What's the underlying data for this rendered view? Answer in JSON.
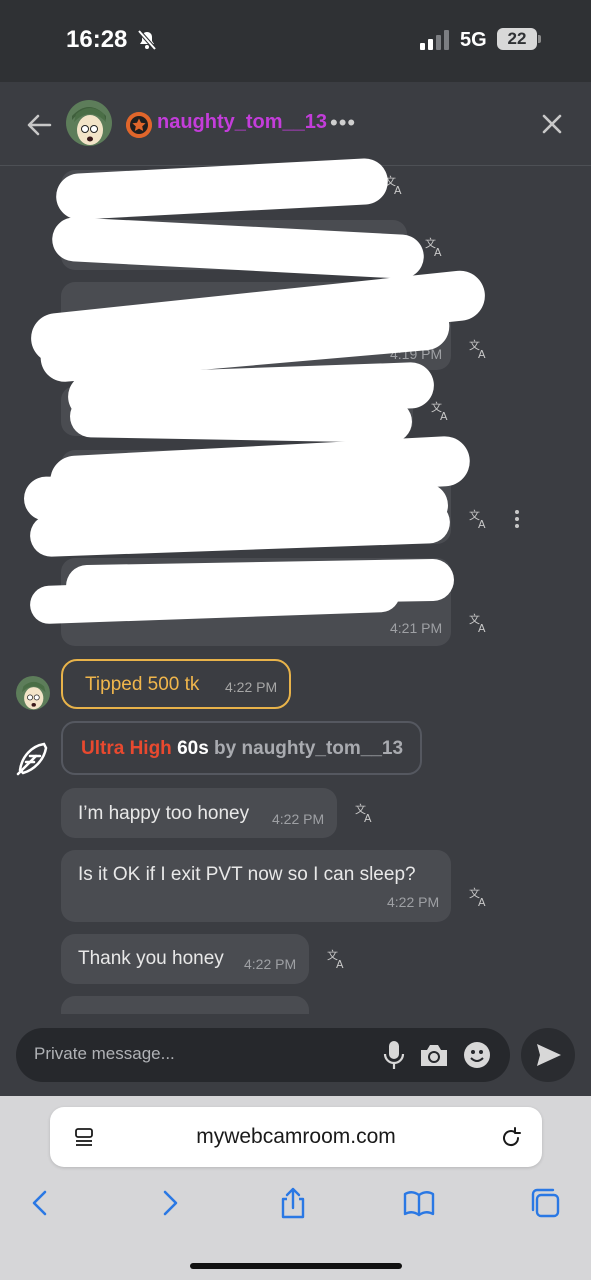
{
  "status_bar": {
    "time": "16:28",
    "network": "5G",
    "battery": "22"
  },
  "header": {
    "username": "naughty_tom__13",
    "username_color": "#c33dda",
    "badge_color": "#e0662b",
    "more": "•••"
  },
  "messages": {
    "time_1": "4:19 PM",
    "time_2": "4:21 PM",
    "m1_text": "I’m happy too honey",
    "m1_time": "4:22 PM",
    "m2_text": "Is it OK if I exit PVT now so I can sleep?",
    "m2_time": "4:22 PM",
    "m3_text": "Thank you honey",
    "m3_time": "4:22 PM"
  },
  "tip": {
    "label": "Tipped 500 tk",
    "time": "4:22 PM",
    "border_color": "#e8b34a"
  },
  "ultra": {
    "level": "Ultra High",
    "duration": "60s",
    "by": "by",
    "user": "naughty_tom__13",
    "level_color": "#e8492f"
  },
  "composer": {
    "placeholder": "Private message..."
  },
  "browser": {
    "url": "mywebcamroom.com"
  },
  "icons": [
    "bell-slash-icon",
    "signal-icon",
    "back-arrow-icon",
    "avatar",
    "star-badge-icon",
    "more-icon",
    "close-icon",
    "translate-icon",
    "kebab-icon",
    "feather-icon",
    "mic-icon",
    "camera-icon",
    "emoji-icon",
    "send-icon",
    "reader-icon",
    "reload-icon",
    "chevron-left-icon",
    "chevron-right-icon",
    "share-icon",
    "bookmarks-icon",
    "tabs-icon"
  ]
}
